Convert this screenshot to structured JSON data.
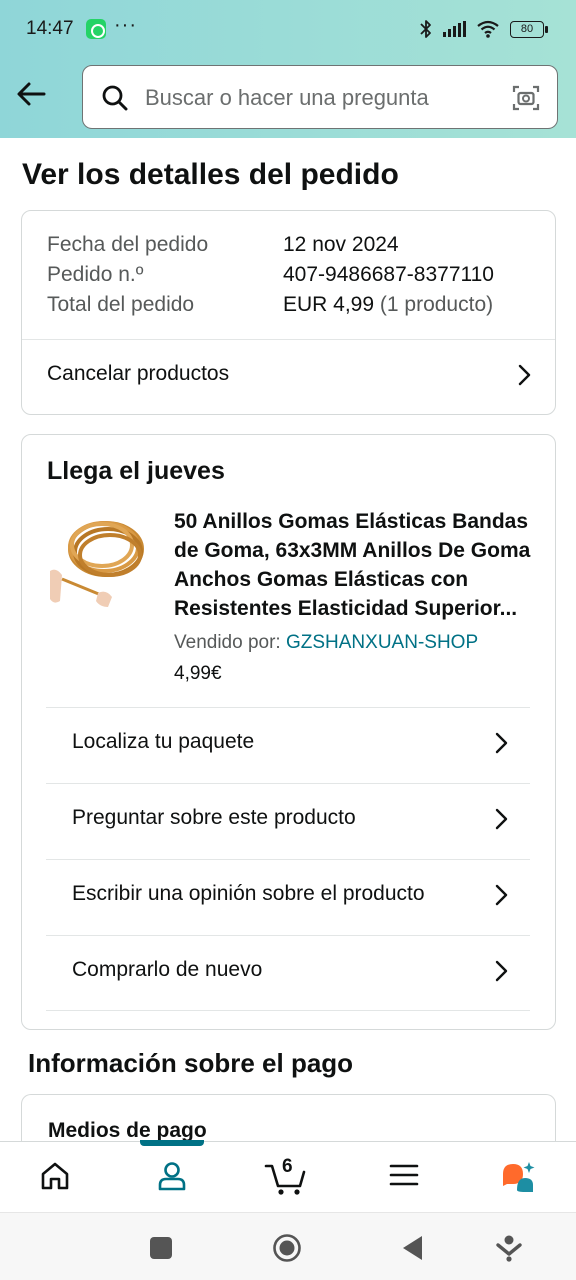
{
  "status_bar": {
    "time": "14:47",
    "dots": "···",
    "battery": "80"
  },
  "search": {
    "placeholder": "Buscar o hacer una pregunta"
  },
  "page": {
    "title": "Ver los detalles del pedido"
  },
  "order_summary": {
    "rows": [
      {
        "label": "Fecha del pedido",
        "value": "12 nov 2024",
        "extra": ""
      },
      {
        "label": "Pedido n.º",
        "value": "407-9486687-8377110",
        "extra": ""
      },
      {
        "label": "Total del pedido",
        "value": "EUR 4,99",
        "extra": "(1 producto)"
      }
    ],
    "cancel_label": "Cancelar productos"
  },
  "delivery": {
    "heading": "Llega el jueves",
    "product": {
      "title": "50 Anillos Gomas Elásticas Bandas de Goma, 63x3MM Anillos De Goma Anchos Gomas Elásticas con Resistentes Elasticidad Superior...",
      "seller_label": "Vendido por:",
      "seller_name": "GZSHANXUAN-SHOP",
      "price": "4,99€"
    },
    "actions": [
      {
        "label": "Localiza tu paquete"
      },
      {
        "label": "Preguntar sobre este producto"
      },
      {
        "label": "Escribir una opinión sobre el producto"
      },
      {
        "label": "Comprarlo de nuevo"
      }
    ]
  },
  "payment": {
    "heading": "Información sobre el pago",
    "card_title": "Medios de pago"
  },
  "bottom_nav": {
    "cart_count": "6",
    "items": [
      {
        "icon": "home-icon"
      },
      {
        "icon": "account-icon",
        "active": true
      },
      {
        "icon": "cart-icon"
      },
      {
        "icon": "menu-icon"
      },
      {
        "icon": "rufus-assistant-icon"
      }
    ]
  },
  "colors": {
    "header_gradient": "#8fd6d8",
    "link": "#007185",
    "active_indicator": "#007185",
    "assistant_orange": "#ff6a2b",
    "assistant_teal": "#1d8ea3"
  }
}
